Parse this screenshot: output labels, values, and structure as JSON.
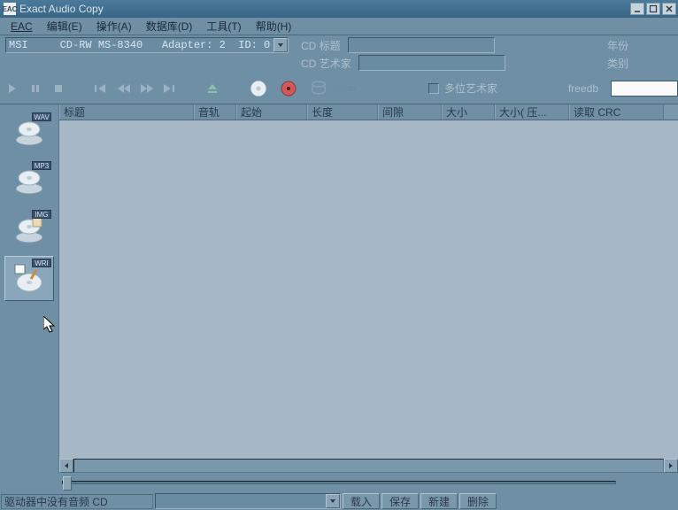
{
  "window": {
    "title": "Exact Audio Copy"
  },
  "menu": {
    "eac": "EAC",
    "edit": "编辑(E)",
    "action": "操作(A)",
    "database": "数据库(D)",
    "tools": "工具(T)",
    "help": "帮助(H)"
  },
  "drive": {
    "selector_text": "MSI     CD-RW MS-8340   Adapter: 2  ID: 0"
  },
  "meta": {
    "cd_title_label": "CD 标题",
    "cd_artist_label": "CD 艺术家",
    "year_label": "年份",
    "genre_label": "类别",
    "multiartist_label": "多位艺术家",
    "freedb_label": "freedb"
  },
  "columns": {
    "title": "标题",
    "track": "音轨",
    "start": "起始",
    "length": "长度",
    "gap": "间隙",
    "size": "大小",
    "compsize": "大小( 压...",
    "readcrc": "读取 CRC"
  },
  "side": {
    "wav": "WAV",
    "mp3": "MP3",
    "img": "IMG",
    "wri": "WRI"
  },
  "status": {
    "text": "驱动器中没有音频 CD"
  },
  "buttons": {
    "load": "载入",
    "save": "保存",
    "new": "新建",
    "delete": "删除"
  }
}
